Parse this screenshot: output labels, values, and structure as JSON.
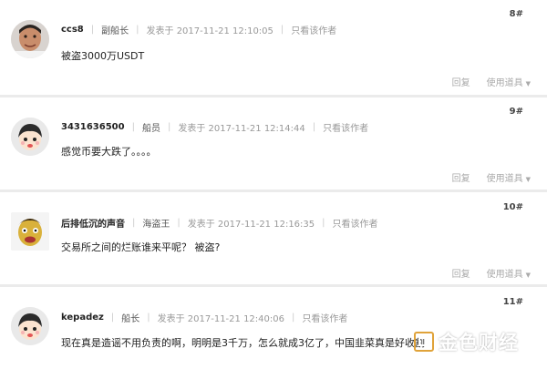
{
  "posts": [
    {
      "floor": "8#",
      "username": "ccs8",
      "rank": "副船长",
      "posted_at": "发表于 2017-11-21 12:10:05",
      "author_only": "只看该作者",
      "content": "被盗3000万USDT",
      "reply": "回复",
      "tools": "使用道具",
      "avatar_icon": "photo-avatar-icon"
    },
    {
      "floor": "9#",
      "username": "3431636500",
      "rank": "船员",
      "posted_at": "发表于 2017-11-21 12:14:44",
      "author_only": "只看该作者",
      "content": "感觉币要大跌了。。。。",
      "reply": "回复",
      "tools": "使用道具",
      "avatar_icon": "cartoon-avatar-icon"
    },
    {
      "floor": "10#",
      "username": "后排低沉的声音",
      "rank": "海盗王",
      "posted_at": "发表于 2017-11-21 12:16:35",
      "author_only": "只看该作者",
      "content": "交易所之间的烂账谁来平呢？ 被盗?",
      "reply": "回复",
      "tools": "使用道具",
      "avatar_icon": "photo-avatar-icon"
    },
    {
      "floor": "11#",
      "username": "kepadez",
      "rank": "船长",
      "posted_at": "发表于 2017-11-21 12:40:06",
      "author_only": "只看该作者",
      "content": "现在真是造谣不用负责的啊，明明是3千万，怎么就成3亿了，中国韭菜真是好收割",
      "avatar_icon": "cartoon-avatar-icon"
    }
  ],
  "watermark": {
    "text": "金色财经"
  },
  "colors": {
    "divider": "#ebebeb",
    "meta": "#999999",
    "text": "#222222"
  }
}
